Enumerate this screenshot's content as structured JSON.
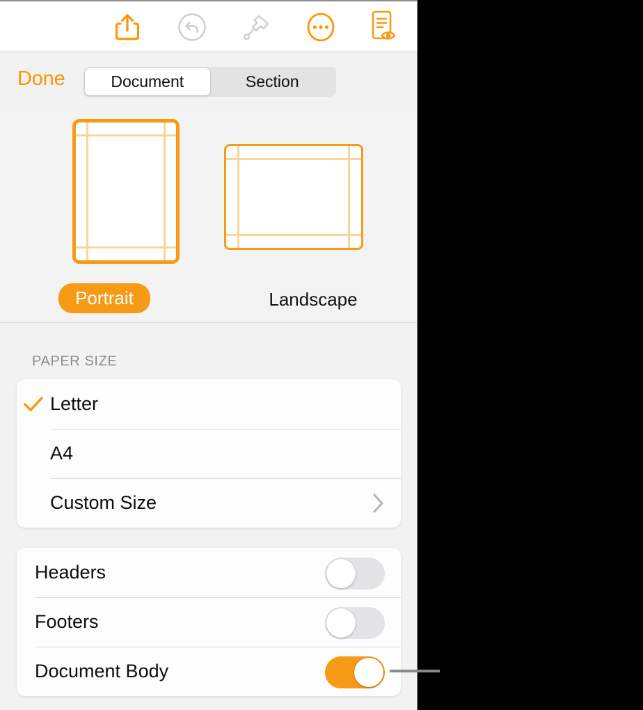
{
  "toolbar": {
    "buttons": [
      {
        "name": "share-icon",
        "label": "Share",
        "state": "enabled"
      },
      {
        "name": "undo-icon",
        "label": "Undo",
        "state": "disabled"
      },
      {
        "name": "paintbrush-icon",
        "label": "Format",
        "state": "disabled"
      },
      {
        "name": "more-icon",
        "label": "More",
        "state": "enabled"
      },
      {
        "name": "document-options-icon",
        "label": "Document Options",
        "state": "enabled"
      }
    ]
  },
  "header": {
    "done_label": "Done",
    "tabs": [
      {
        "label": "Document",
        "selected": true
      },
      {
        "label": "Section",
        "selected": false
      }
    ]
  },
  "orientation": {
    "options": [
      {
        "label": "Portrait",
        "selected": true
      },
      {
        "label": "Landscape",
        "selected": false
      }
    ]
  },
  "paper_size": {
    "section_title": "PAPER SIZE",
    "items": [
      {
        "label": "Letter",
        "checked": true,
        "accessory": "checkmark-icon"
      },
      {
        "label": "A4",
        "checked": false,
        "accessory": ""
      },
      {
        "label": "Custom Size",
        "checked": false,
        "accessory": "chevron-right-icon"
      }
    ]
  },
  "toggles": {
    "items": [
      {
        "label": "Headers",
        "on": false
      },
      {
        "label": "Footers",
        "on": false
      },
      {
        "label": "Document Body",
        "on": true
      }
    ]
  },
  "colors": {
    "accent_orange": "#FF9500",
    "thumb_orange": "#F79A16",
    "guide_orange": "#FBD49A",
    "panel_background": "#F2F2F2",
    "card_background": "#FDFDFD",
    "switch_off": "#E4E4E6",
    "callout_gray": "#8A8A8A",
    "backdrop": "#000000"
  }
}
